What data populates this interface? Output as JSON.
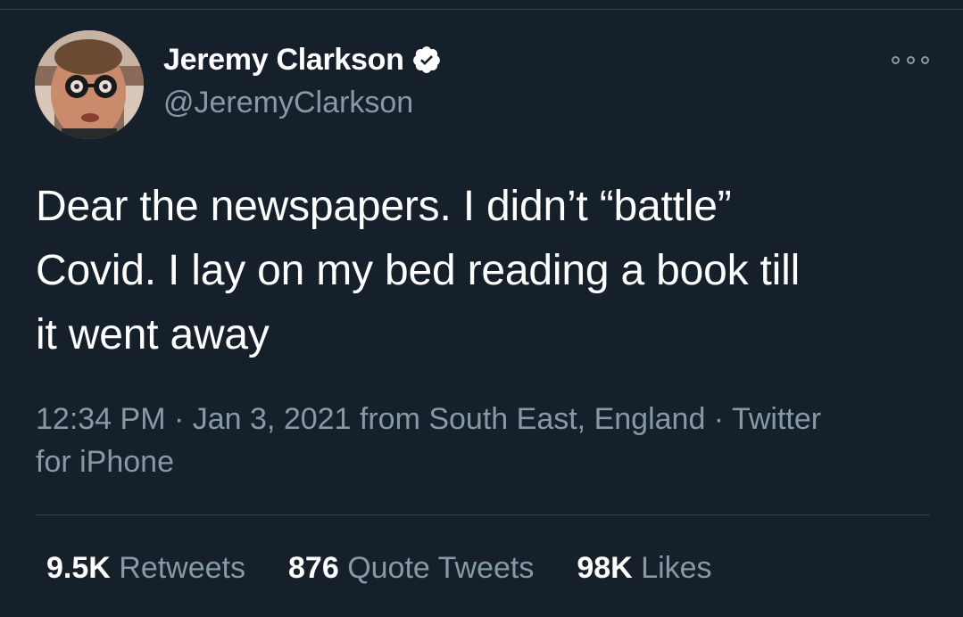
{
  "user": {
    "display_name": "Jeremy Clarkson",
    "handle": "@JeremyClarkson",
    "verified": true,
    "avatar_icon": "profile-photo"
  },
  "more_icon": "more-options-icon",
  "tweet": {
    "text_lines": [
      "Dear the newspapers. I didn’t “battle”",
      "Covid. I lay on my bed reading a book till",
      "it went away"
    ]
  },
  "meta": {
    "time": "12:34 PM",
    "sep1": " · ",
    "date": "Jan 3, 2021",
    "location": " from South East, England",
    "sep2": " · ",
    "source_line1": "Twitter",
    "source_line2": "for iPhone"
  },
  "stats": {
    "retweets_count": "9.5K",
    "retweets_label": " Retweets",
    "quotes_count": "876",
    "quotes_label": " Quote Tweets",
    "likes_count": "98K",
    "likes_label": " Likes"
  },
  "colors": {
    "background": "#15202b",
    "text": "#ffffff",
    "secondary": "#8899a6",
    "verified": "#ffffff",
    "divider": "#38444d"
  }
}
